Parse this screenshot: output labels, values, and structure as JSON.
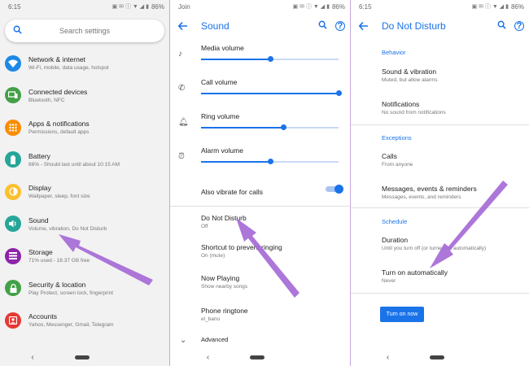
{
  "panel1": {
    "status": {
      "time": "6:15",
      "battery": "86%"
    },
    "search_placeholder": "Search settings",
    "items": [
      {
        "title": "Network & internet",
        "subtitle": "Wi-Fi, mobile, data usage, hotspot",
        "icon": "wifi-icon",
        "color": "#1e88e5"
      },
      {
        "title": "Connected devices",
        "subtitle": "Bluetooth, NFC",
        "icon": "devices-icon",
        "color": "#43a047"
      },
      {
        "title": "Apps & notifications",
        "subtitle": "Permissions, default apps",
        "icon": "apps-icon",
        "color": "#fb8c00"
      },
      {
        "title": "Battery",
        "subtitle": "86% - Should last until about 10:15 AM",
        "icon": "battery-icon",
        "color": "#26a69a"
      },
      {
        "title": "Display",
        "subtitle": "Wallpaper, sleep, font size",
        "icon": "display-icon",
        "color": "#fbc02d"
      },
      {
        "title": "Sound",
        "subtitle": "Volume, vibration, Do Not Disturb",
        "icon": "sound-icon",
        "color": "#26a69a"
      },
      {
        "title": "Storage",
        "subtitle": "71% used - 18.37 GB free",
        "icon": "storage-icon",
        "color": "#8e24aa"
      },
      {
        "title": "Security & location",
        "subtitle": "Play Protect, screen lock, fingerprint",
        "icon": "lock-icon",
        "color": "#43a047"
      },
      {
        "title": "Accounts",
        "subtitle": "Yahoo, Messenger, Gmail, Telegram",
        "icon": "account-icon",
        "color": "#e53935"
      }
    ]
  },
  "panel2": {
    "status": {
      "left": "Join",
      "battery": "86%"
    },
    "title": "Sound",
    "volumes": [
      {
        "title": "Media volume",
        "level": 0.5,
        "icon": "music-note-icon"
      },
      {
        "title": "Call volume",
        "level": 1.0,
        "icon": "phone-icon"
      },
      {
        "title": "Ring volume",
        "level": 0.6,
        "icon": "bell-icon"
      },
      {
        "title": "Alarm volume",
        "level": 0.5,
        "icon": "alarm-icon"
      }
    ],
    "vibrate": {
      "title": "Also vibrate for calls",
      "on": true
    },
    "rows": [
      {
        "title": "Do Not Disturb",
        "subtitle": "Off"
      },
      {
        "title": "Shortcut to prevent ringing",
        "subtitle": "On (mute)"
      },
      {
        "title": "Now Playing",
        "subtitle": "Show nearby songs"
      },
      {
        "title": "Phone ringtone",
        "subtitle": "el_bano"
      }
    ],
    "advanced": "Advanced"
  },
  "panel3": {
    "status": {
      "time": "6:15",
      "battery": "86%"
    },
    "title": "Do Not Disturb",
    "behavior_label": "Behavior",
    "behavior": [
      {
        "title": "Sound & vibration",
        "subtitle": "Muted, but allow alarms"
      },
      {
        "title": "Notifications",
        "subtitle": "No sound from notifications"
      }
    ],
    "exceptions_label": "Exceptions",
    "exceptions": [
      {
        "title": "Calls",
        "subtitle": "From anyone"
      },
      {
        "title": "Messages, events & reminders",
        "subtitle": "Messages, events, and reminders"
      }
    ],
    "schedule_label": "Schedule",
    "schedule": [
      {
        "title": "Duration",
        "subtitle": "Until you turn off (or turned on automatically)"
      },
      {
        "title": "Turn on automatically",
        "subtitle": "Never"
      }
    ],
    "button": "Turn on now"
  },
  "colors": {
    "accent": "#1a73e8",
    "arrow": "#a66ad6"
  }
}
